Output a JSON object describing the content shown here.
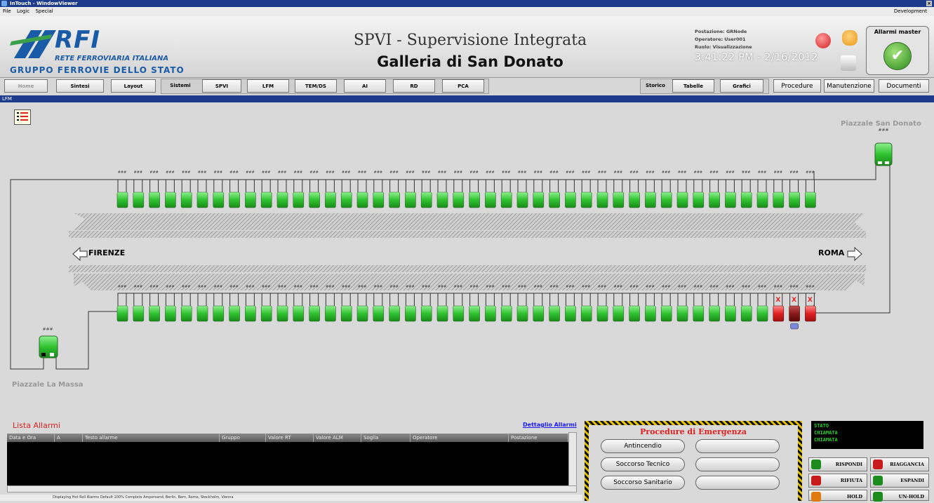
{
  "window": {
    "title": "InTouch - WindowViewer"
  },
  "menu": {
    "items": [
      "File",
      "Logic",
      "Special"
    ],
    "right": "Development"
  },
  "logo": {
    "brand": "RFI",
    "subtitle": "RETE FERROVIARIA ITALIANA",
    "group": "GRUPPO FERROVIE DELLO STATO"
  },
  "header": {
    "title": "SPVI - Supervisione Integrata",
    "subtitle": "Galleria di San Donato"
  },
  "session": {
    "postazione": "Postazione: GRNode",
    "operatore": "Operatore: User001",
    "ruolo": "Ruolo: Visualizzazione",
    "clock": "3:41:22 PM - 2/16/2012"
  },
  "alarm_master": {
    "label": "Allarmi master"
  },
  "nav": {
    "home": "Home",
    "sintesi": "Sintesi",
    "layout": "Layout",
    "sistemi": "Sistemi",
    "spvi": "SPVI",
    "lfm": "LFM",
    "temds": "TEM/DS",
    "ai": "AI",
    "rd": "RD",
    "pca": "PCA",
    "storico": "Storico",
    "tabelle": "Tabelle",
    "grafici": "Grafici",
    "procedure": "Procedure",
    "manutenzione": "Manutenzione",
    "documenti": "Documenti"
  },
  "section": {
    "label": "LFM"
  },
  "tunnel": {
    "piazzale_sd": "Piazzale San Donato",
    "piazzale_lm": "Piazzale La Massa",
    "west": "FIRENZE",
    "east": "ROMA",
    "unit_label": "###",
    "fault_mark": "X",
    "top_units": 44,
    "bottom_units": 44,
    "bottom_status": [
      "ok",
      "ok",
      "ok",
      "ok",
      "ok",
      "ok",
      "ok",
      "ok",
      "ok",
      "ok",
      "ok",
      "ok",
      "ok",
      "ok",
      "ok",
      "ok",
      "ok",
      "ok",
      "ok",
      "ok",
      "ok",
      "ok",
      "ok",
      "ok",
      "ok",
      "ok",
      "ok",
      "ok",
      "ok",
      "ok",
      "ok",
      "ok",
      "ok",
      "ok",
      "ok",
      "ok",
      "ok",
      "ok",
      "ok",
      "ok",
      "ok",
      "fault",
      "alarm",
      "fault"
    ],
    "colors": {
      "ok": "#2fc22f",
      "fault": "#e02020",
      "alarm": "#8b1a1a"
    }
  },
  "alarms": {
    "title": "Lista Allarmi",
    "detail_link": "Dettaglio Allarmi",
    "columns": [
      "Data e Ora",
      "A",
      "Testo allarme",
      "Gruppo",
      "Valore RT",
      "Valore ALM",
      "Soglia",
      "Operatore",
      "Postazione"
    ],
    "status": "Displaying Hot Roll Alarms   Default   100% Complete   Ampersand, Berlin, Bern, Rome, Stockholm, Vienna"
  },
  "emergency": {
    "title": "Procedure di Emergenza",
    "buttons": [
      "Antincendio",
      "Soccorso Tecnico",
      "Soccorso Sanitario"
    ]
  },
  "phone": {
    "status": [
      "STATO",
      "CHIAMATA",
      "CHIAMATA"
    ],
    "buttons": [
      "RISPONDI",
      "RIAGGANCIA",
      "RIFIUTA",
      "ESPANDI",
      "HOLD",
      "UN-HOLD"
    ]
  }
}
